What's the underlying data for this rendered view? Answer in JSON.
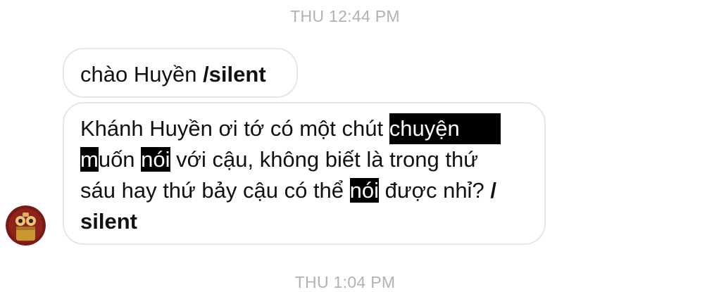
{
  "timestamps": {
    "top": "THU 12:44 PM",
    "bottom": "THU 1:04 PM"
  },
  "messages": [
    {
      "plain": "chào Huyền ",
      "bold": "/silent"
    },
    {
      "line1_plain": "Khánh Huyền ơi tớ có một chút ",
      "line1_highlight": "chuyện",
      "line2_highlight_m": "m",
      "line2_plain_a": "uốn ",
      "line2_highlight": "nói",
      "line2_plain_b": " với cậu, không biết là trong thứ",
      "line3_plain_a": "sáu hay thứ bảy cậu có thể ",
      "line3_highlight": "nói",
      "line3_plain_b": " được nhỉ? ",
      "line3_bold": "/",
      "line4_bold": "silent"
    }
  ],
  "avatar": {
    "icon": "contact-avatar-icon",
    "colors": {
      "background": "#7a1a14",
      "accent": "#c9962f"
    }
  },
  "colors": {
    "timestamp": "#b2b2b2",
    "bubble_border": "#e6e6e6",
    "text": "#111111",
    "highlight_bg": "#000000",
    "highlight_text": "#ffffff"
  }
}
